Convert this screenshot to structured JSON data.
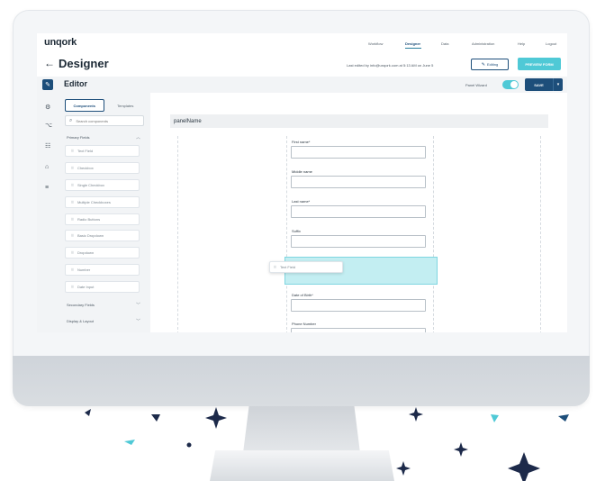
{
  "brand": {
    "logo": "unqork",
    "accent": "#4fc9d6",
    "primary": "#1d4e7a"
  },
  "topnav": {
    "items": [
      "Workflow",
      "Designer",
      "Data",
      "Administration",
      "Help",
      "Logout"
    ],
    "active": "Designer"
  },
  "header": {
    "back_icon": "arrow-left-icon",
    "title": "Designer",
    "edited_text": "Last edited by info@unqork.com at 5:13 AM on June 5",
    "editing_label": "Editing",
    "preview_label": "PREVIEW FORM"
  },
  "editor": {
    "title": "Editor",
    "pw_label": "Panel Wizard",
    "toggle_on": true,
    "save_label": "SAVE",
    "save_caret": "▾"
  },
  "rail": {
    "icons": [
      "pencil-icon",
      "gear-icon",
      "code-icon",
      "layers-icon",
      "shapes-icon",
      "sliders-icon"
    ]
  },
  "components": {
    "tabs": [
      "Components",
      "Templates"
    ],
    "active_tab": "Components",
    "search_placeholder": "Search components",
    "primary_label": "Primary Fields",
    "primary_items": [
      "Text Field",
      "Checkbox",
      "Single Checkbox",
      "Multiple Checkboxes",
      "Radio Buttons",
      "Basic Dropdown",
      "Dropdown",
      "Number",
      "Date Input"
    ],
    "secondary_label": "Secondary Fields",
    "layout_label": "Display & Layout"
  },
  "canvas": {
    "panel_name": "panelName",
    "fields": [
      {
        "label": "First name*"
      },
      {
        "label": "Middle name"
      },
      {
        "label": "Last name*"
      },
      {
        "label": "Suffix"
      },
      {
        "label": "Date of Birth*"
      },
      {
        "label": "Phone Number"
      }
    ],
    "drag_chip": "Text Field"
  }
}
